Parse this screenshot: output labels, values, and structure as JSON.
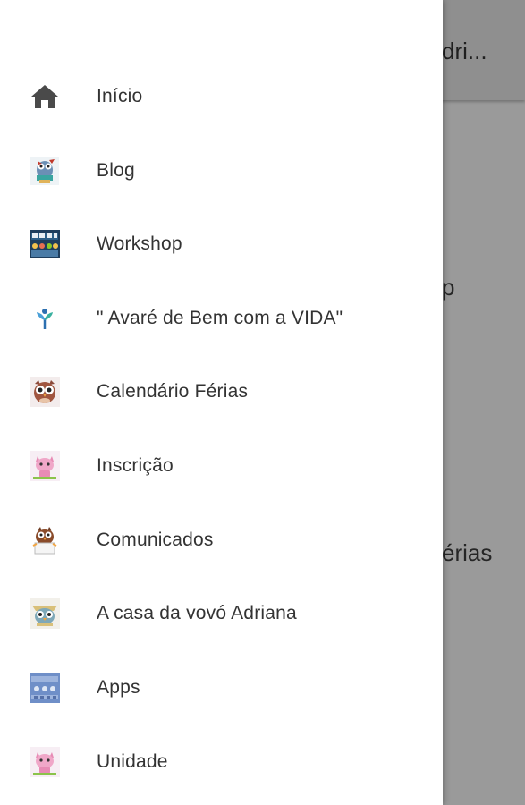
{
  "app": {
    "title_partial": "dri...",
    "bg_text_1": "p",
    "bg_text_2": "érias"
  },
  "drawer": {
    "items": [
      {
        "label": "Início",
        "icon": "home-icon"
      },
      {
        "label": "Blog",
        "icon": "owl-book-icon"
      },
      {
        "label": "Workshop",
        "icon": "workshop-icon"
      },
      {
        "label": "\" Avaré de Bem com a VIDA\"",
        "icon": "sprout-logo-icon"
      },
      {
        "label": "Calendário Férias",
        "icon": "owl-icon"
      },
      {
        "label": "Inscrição",
        "icon": "pink-cat-icon"
      },
      {
        "label": "Comunicados",
        "icon": "owl-sign-icon"
      },
      {
        "label": "A casa da vovó Adriana",
        "icon": "owl-house-icon"
      },
      {
        "label": "Apps",
        "icon": "apps-banner-icon"
      },
      {
        "label": "Unidade",
        "icon": "pink-cat-icon"
      }
    ]
  },
  "colors": {
    "drawer_bg": "#ffffff",
    "scrim": "#9a9a9a",
    "label_text": "#333333",
    "home_icon": "#4a4a4a"
  }
}
